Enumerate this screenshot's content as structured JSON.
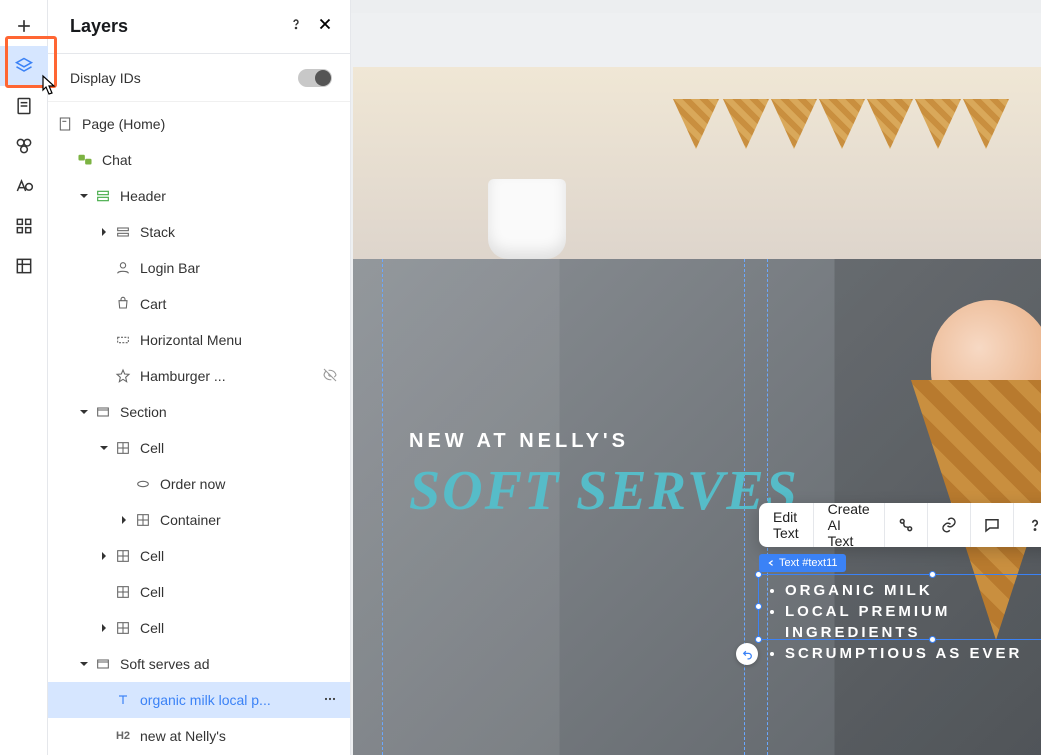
{
  "panel": {
    "title": "Layers",
    "display_ids_label": "Display IDs",
    "display_ids_on": false
  },
  "tree": {
    "root": "Page (Home)",
    "chat": "Chat",
    "header": "Header",
    "stack": "Stack",
    "login_bar": "Login Bar",
    "cart": "Cart",
    "horizontal_menu": "Horizontal Menu",
    "hamburger": "Hamburger ...",
    "section": "Section",
    "cell1": "Cell",
    "order_now": "Order now",
    "container": "Container",
    "cell2": "Cell",
    "cell3": "Cell",
    "cell4": "Cell",
    "soft_serves_ad": "Soft serves ad",
    "organic_text": "organic milk local p...",
    "new_at_nellys": "new at Nelly's"
  },
  "float": {
    "edit_text": "Edit Text",
    "create_ai_text": "Create AI Text"
  },
  "selection": {
    "tag": "Text #text11"
  },
  "hero": {
    "subtitle": "NEW AT NELLY'S",
    "title": "SOFT SERVES",
    "bullets": [
      "ORGANIC MILK",
      "LOCAL PREMIUM INGREDIENTS",
      "SCRUMPTIOUS AS EVER"
    ]
  },
  "heading_level": "H2"
}
